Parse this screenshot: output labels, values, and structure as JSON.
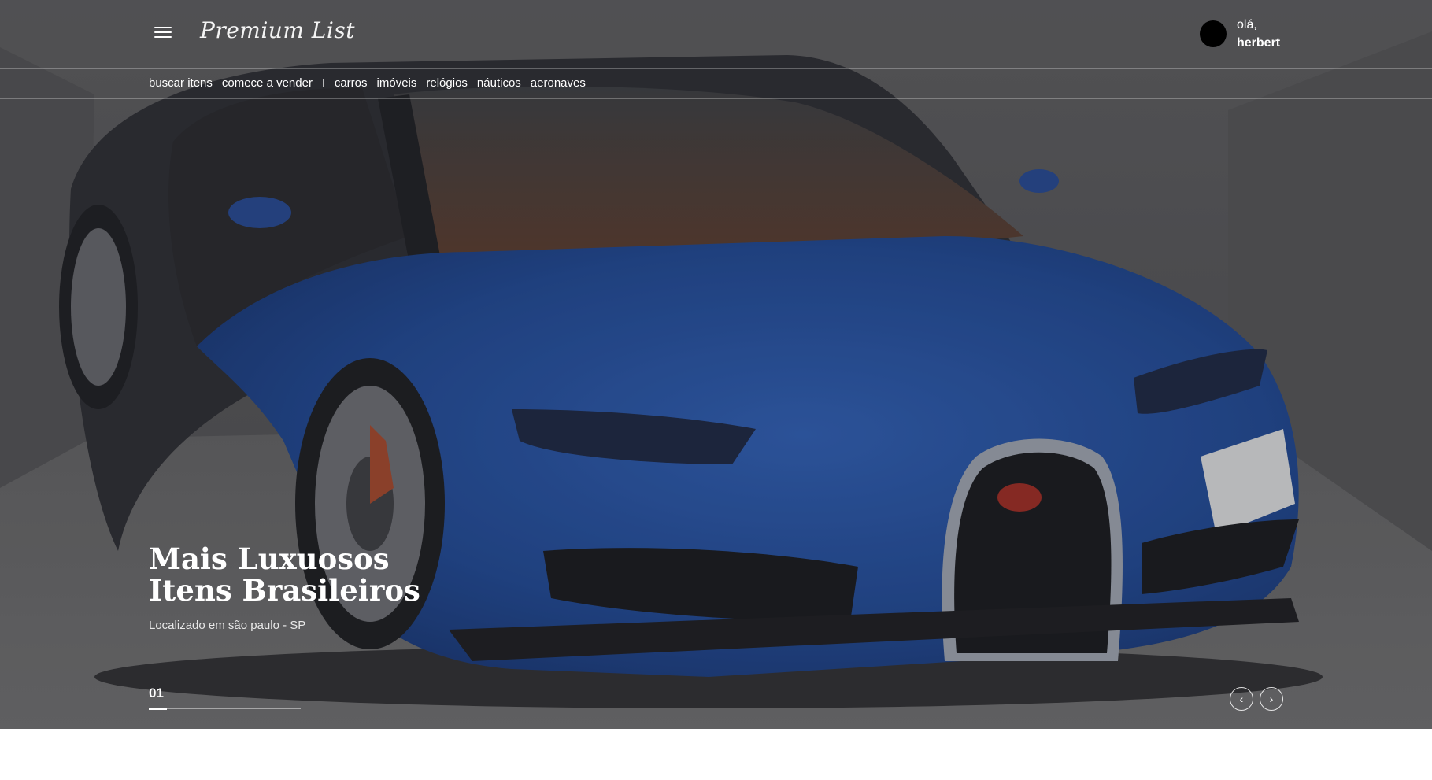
{
  "header": {
    "logo_text": "Premium List",
    "greeting": "olá,",
    "username": "herbert"
  },
  "nav": {
    "items": [
      {
        "label": "buscar itens"
      },
      {
        "label": "comece a vender"
      },
      {
        "label": "carros"
      },
      {
        "label": "imóveis"
      },
      {
        "label": "relógios"
      },
      {
        "label": "náuticos"
      },
      {
        "label": "aeronaves"
      }
    ],
    "separator": "I"
  },
  "hero": {
    "title_line1": "Mais Luxuosos",
    "title_line2": "Itens Brasileiros",
    "location": "Localizado em são paulo - SP",
    "slide_number": "01",
    "slide_progress": 0.12,
    "background_image": "blue Bugatti Chiron in a garage"
  },
  "controls": {
    "prev_icon": "chevron-left-icon",
    "next_icon": "chevron-right-icon",
    "prev_glyph": "‹",
    "next_glyph": "›"
  },
  "colors": {
    "text": "#ffffff",
    "overlay": "#3a3a3c",
    "car_blue": "#1f4fa0",
    "avatar": "#000000"
  }
}
